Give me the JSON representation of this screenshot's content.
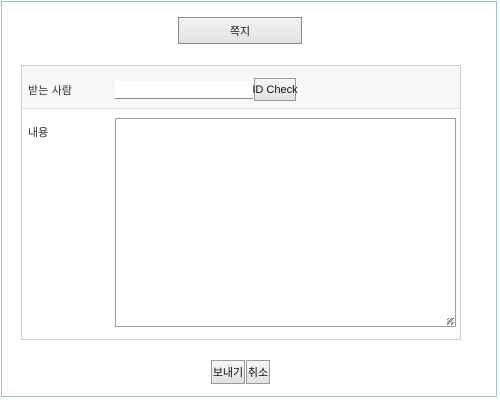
{
  "title": "쪽지",
  "form": {
    "recipient_label": "받는 사람",
    "recipient_value": "",
    "id_check_label": "ID Check",
    "content_label": "내용",
    "content_value": ""
  },
  "buttons": {
    "send_label": "보내기",
    "cancel_label": "취소"
  }
}
